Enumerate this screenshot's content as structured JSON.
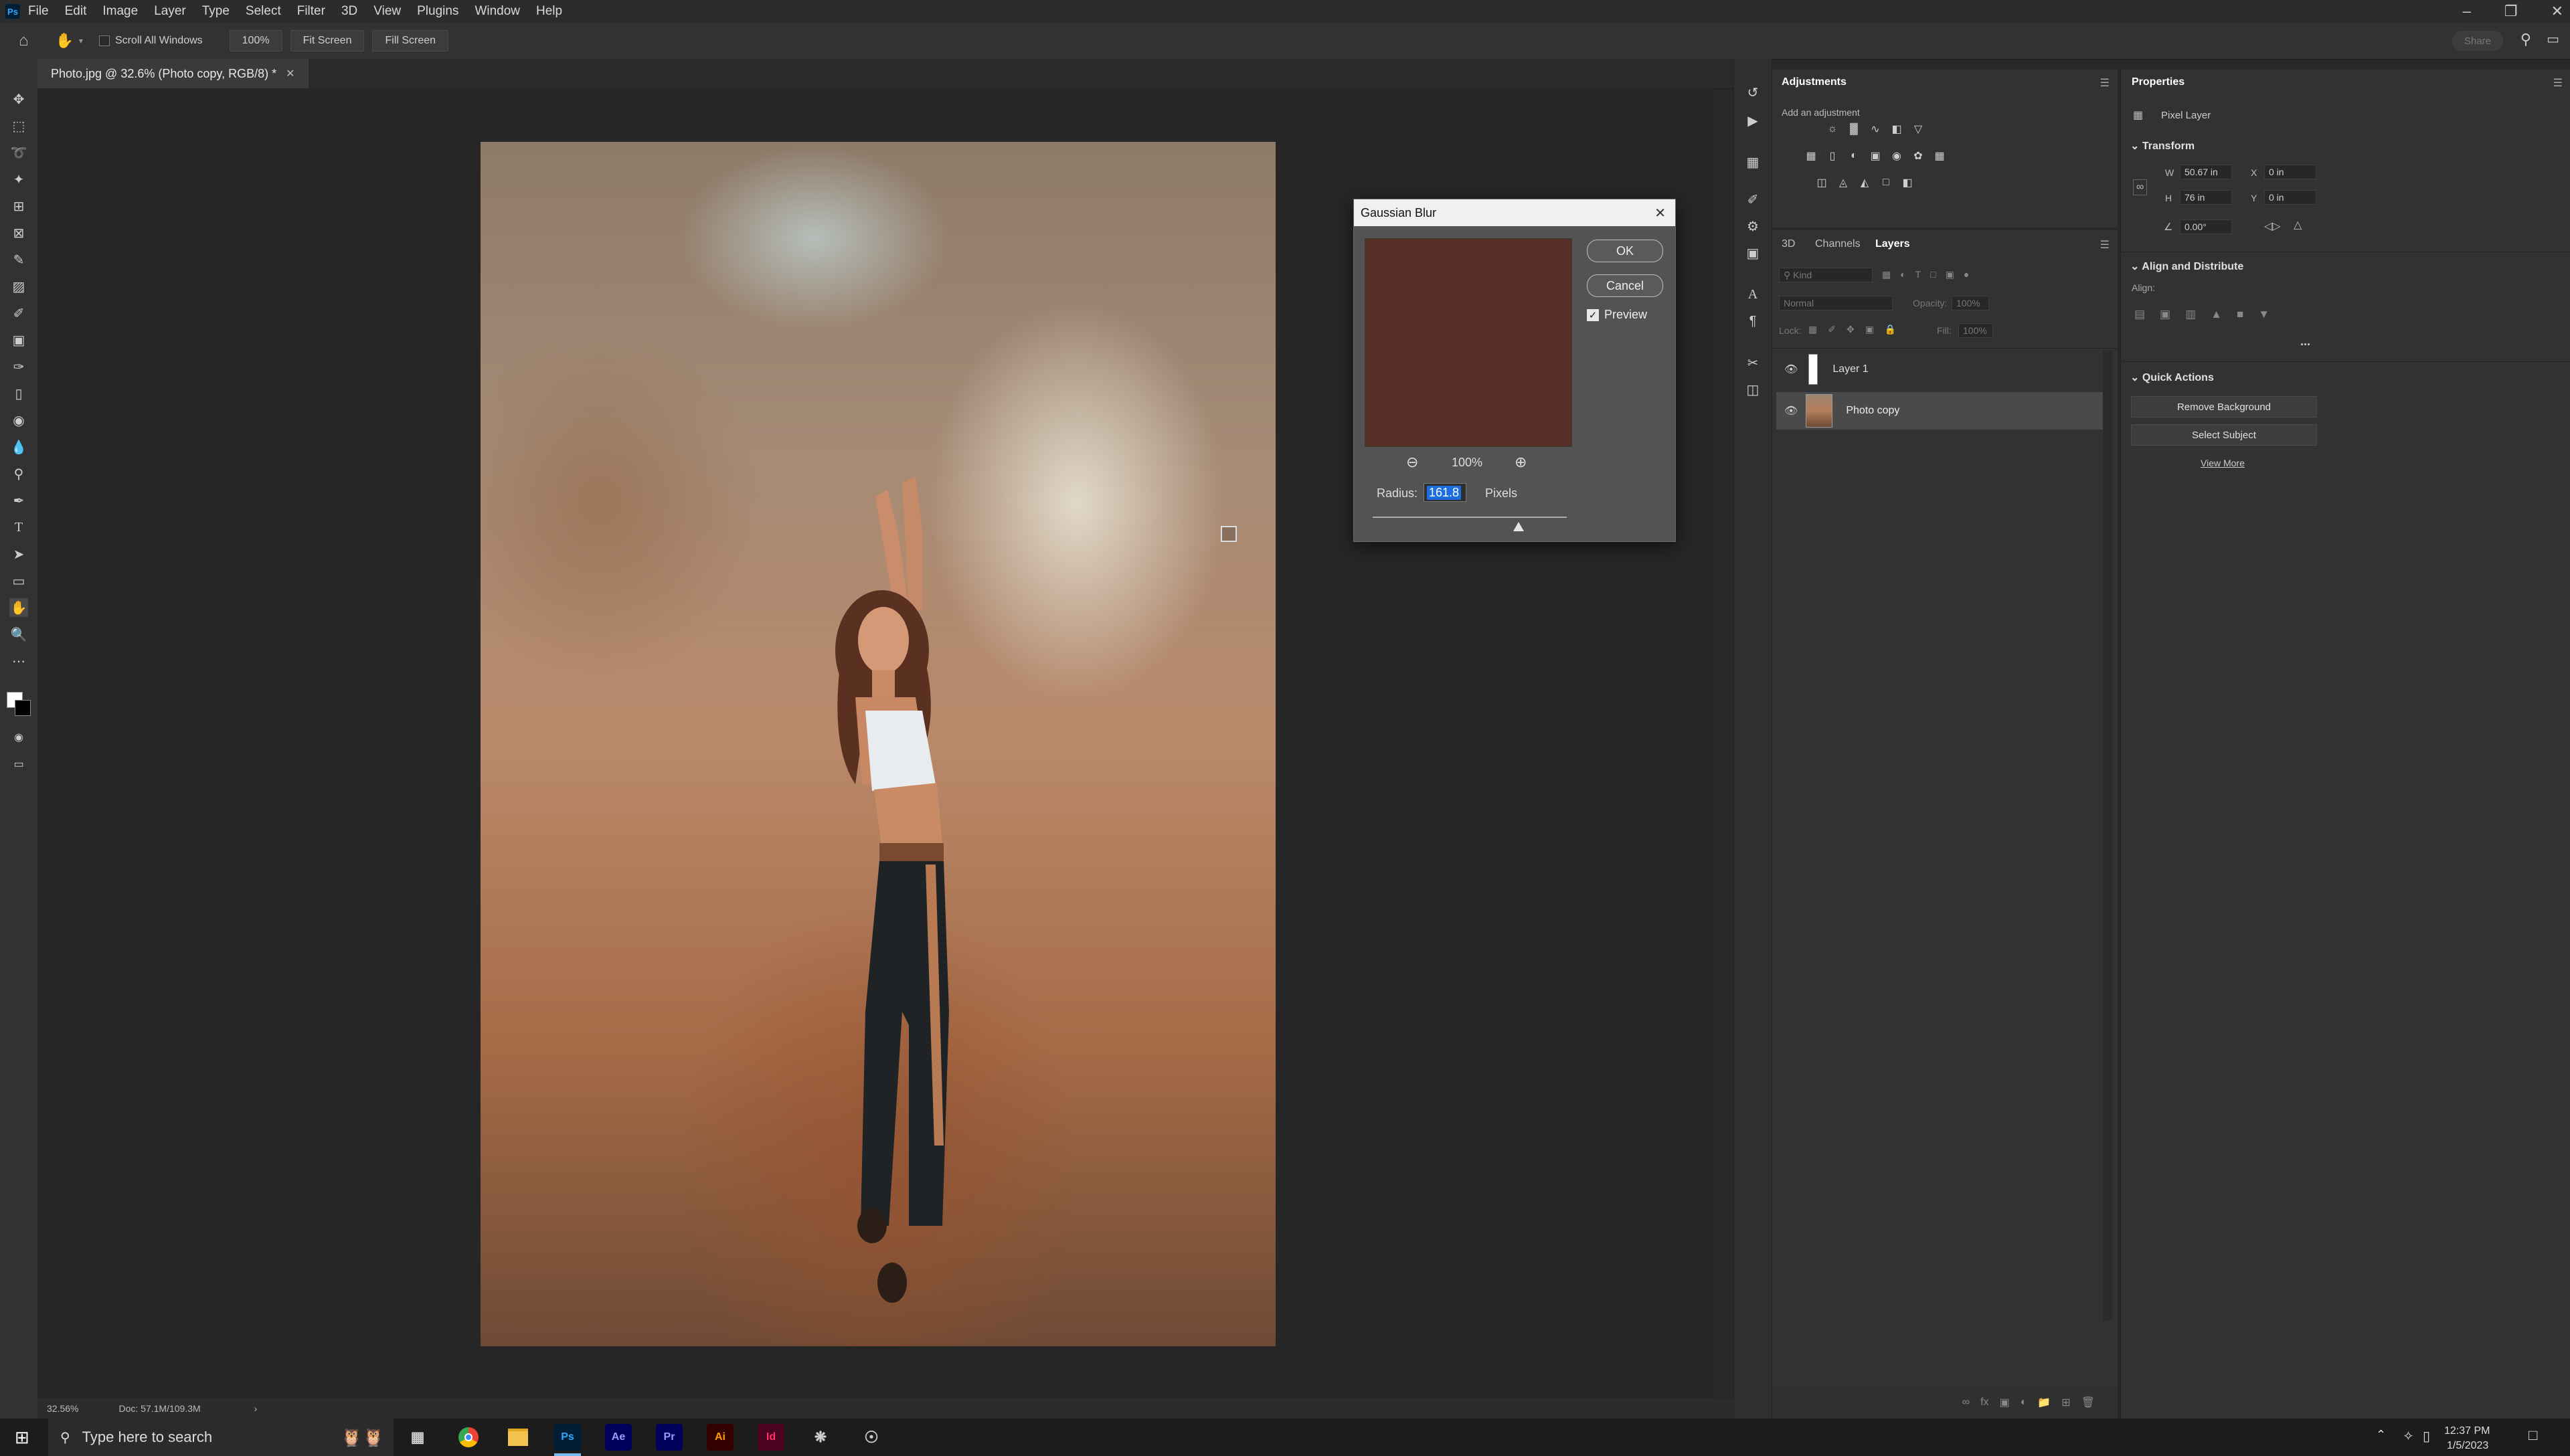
{
  "menu": {
    "logo": "Ps",
    "items": [
      "File",
      "Edit",
      "Image",
      "Layer",
      "Type",
      "Select",
      "Filter",
      "3D",
      "View",
      "Plugins",
      "Window",
      "Help"
    ]
  },
  "options_bar": {
    "scroll_all_windows": "Scroll All Windows",
    "zoom_value": "100%",
    "fit_screen": "Fit Screen",
    "fill_screen": "Fill Screen",
    "share": "Share"
  },
  "document": {
    "tab_title": "Photo.jpg @ 32.6% (Photo copy, RGB/8) *",
    "zoom_status": "32.56%",
    "doc_status": "Doc: 57.1M/109.3M"
  },
  "gaussian_blur": {
    "title": "Gaussian Blur",
    "ok": "OK",
    "cancel": "Cancel",
    "preview_label": "Preview",
    "preview_checked": true,
    "zoom": "100%",
    "radius_label": "Radius:",
    "radius_value": "161.8",
    "radius_unit": "Pixels",
    "slider_fraction": 0.75
  },
  "adjustments": {
    "tab": "Adjustments",
    "hint": "Add an adjustment"
  },
  "layers_panel": {
    "tabs": [
      "3D",
      "Channels",
      "Layers"
    ],
    "active_tab": "Layers",
    "kind_placeholder": "Kind",
    "blend_mode": "Normal",
    "opacity_label": "Opacity:",
    "opacity_value": "100%",
    "lock_label": "Lock:",
    "fill_label": "Fill:",
    "fill_value": "100%",
    "layers": [
      {
        "name": "Layer 1",
        "selected": false
      },
      {
        "name": "Photo copy",
        "selected": true
      }
    ]
  },
  "properties": {
    "tab": "Properties",
    "layer_type": "Pixel Layer",
    "transform": {
      "title": "Transform",
      "w_label": "W",
      "w_value": "50.67 in",
      "h_label": "H",
      "h_value": "76 in",
      "x_label": "X",
      "x_value": "0 in",
      "y_label": "Y",
      "y_value": "0 in",
      "angle_value": "0.00°"
    },
    "align": {
      "title": "Align and Distribute",
      "label": "Align:",
      "more": "..."
    },
    "quick_actions": {
      "title": "Quick Actions",
      "remove_background": "Remove Background",
      "select_subject": "Select Subject",
      "view_more": "View More"
    }
  },
  "taskbar": {
    "search_placeholder": "Type here to search",
    "apps": [
      "Ae",
      "Pr",
      "Ai",
      "Id",
      "Ps"
    ],
    "time": "12:37 PM",
    "date": "1/5/2023"
  },
  "colors": {
    "accent": "#31a8ff",
    "ae": "#9999ff",
    "pr": "#9999ff",
    "ai": "#ff9a00",
    "id": "#ff3366"
  }
}
